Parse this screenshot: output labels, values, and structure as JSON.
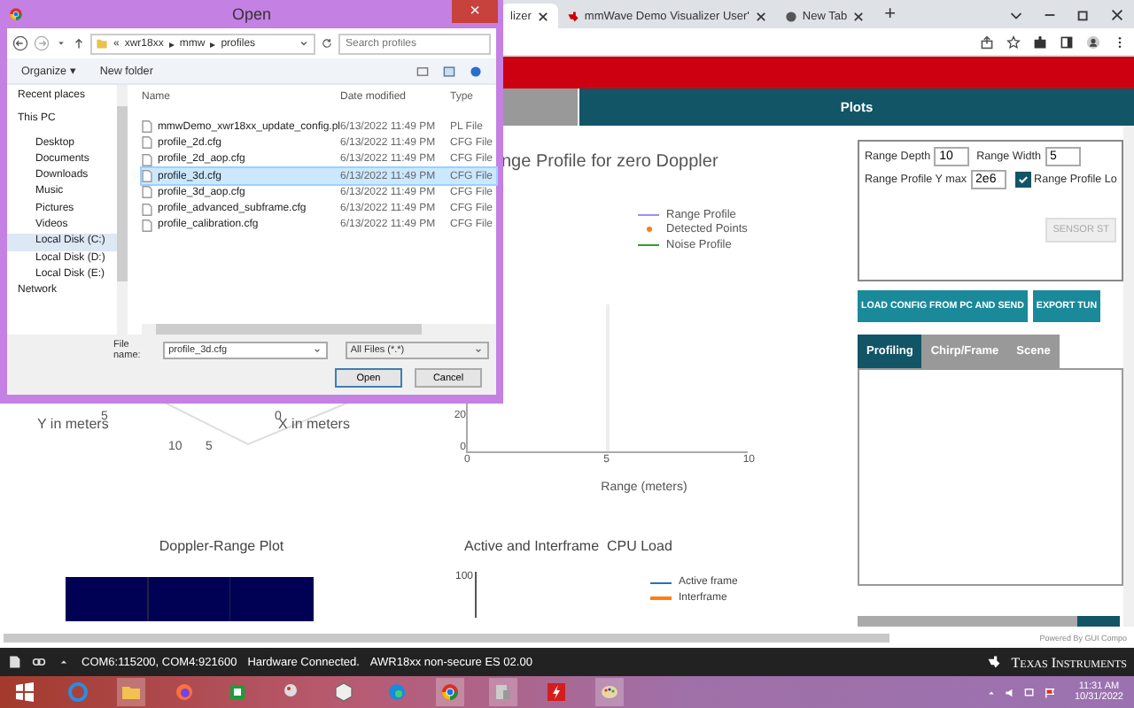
{
  "browser": {
    "tabs": [
      {
        "title": "lizer",
        "selected": true
      },
      {
        "title": "mmWave Demo Visualizer User'",
        "selected": false
      },
      {
        "title": "New Tab",
        "selected": false
      }
    ],
    "new_tab": "+"
  },
  "page_tabs": [
    {
      "selected": false
    },
    {
      "label": "Plots",
      "selected": true
    }
  ],
  "plot_3d": {
    "y_label": "Y in meters",
    "x_label": "X in meters",
    "ticks": [
      "5",
      "0",
      "10",
      "5"
    ]
  },
  "range_profile": {
    "title": "nge Profile for zero Doppler",
    "legend": [
      {
        "label": "Range Profile",
        "kind": "line",
        "color": "#9d8cff"
      },
      {
        "label": "Detected Points",
        "kind": "dot",
        "color": "#ff7f0e"
      },
      {
        "label": "Noise Profile",
        "kind": "line",
        "color": "#2ca02c"
      }
    ],
    "y_ticks": [
      "20",
      "0"
    ],
    "x_ticks": [
      "0",
      "5",
      "10"
    ],
    "xlabel": "Range (meters)"
  },
  "doppler_plot": {
    "title": "Doppler-Range Plot"
  },
  "cpu_load": {
    "title": "Active and Interframe  CPU Load",
    "y_tick": "100",
    "legend": [
      {
        "label": "Active frame",
        "color": "#1f77b4"
      },
      {
        "label": "Interframe",
        "color": "#ff7f0e"
      }
    ]
  },
  "settings": {
    "fields": [
      {
        "label": "Range Depth",
        "value": "10"
      },
      {
        "label": "Range Width",
        "value": "5"
      },
      {
        "label": "Range Profile Y max",
        "value": "2e6"
      }
    ],
    "log_checkbox": {
      "label": "Range Profile Lo",
      "checked": true
    },
    "sensor_button": {
      "label": "SENSOR ST",
      "disabled": true
    }
  },
  "actions": [
    "LOAD CONFIG FROM PC AND SEND",
    "EXPORT TUN"
  ],
  "config_tabs": [
    {
      "label": "Profiling",
      "selected": true
    },
    {
      "label": "Chirp/Frame",
      "selected": false
    },
    {
      "label": "Scene",
      "selected": false
    }
  ],
  "powered_by": "Powered By GUI Compo",
  "status_bar": {
    "ports": "COM6:115200, COM4:921600",
    "connection": "Hardware Connected.",
    "device": "AWR18xx non-secure ES 02.00",
    "brand": "Texas Instruments"
  },
  "taskbar": {
    "time": "11:31 AM",
    "date": "10/31/2022"
  },
  "dialog": {
    "title": "Open",
    "close": "×",
    "path": [
      "«",
      "xwr18xx",
      "▸",
      "mmw",
      "▸",
      "profiles"
    ],
    "search_placeholder": "Search profiles",
    "organize": "Organize ▾",
    "new_folder": "New folder",
    "nav": [
      {
        "label": "Recent places",
        "selected": false
      },
      {
        "label": "This PC",
        "selected": false,
        "children": [
          {
            "label": "Desktop",
            "selected": false
          },
          {
            "label": "Documents",
            "selected": false
          },
          {
            "label": "Downloads",
            "selected": false
          },
          {
            "label": "Music",
            "selected": false
          },
          {
            "label": "Pictures",
            "selected": false
          },
          {
            "label": "Videos",
            "selected": false
          },
          {
            "label": "Local Disk (C:)",
            "selected": true
          },
          {
            "label": "Local Disk (D:)",
            "selected": false
          },
          {
            "label": "Local Disk (E:)",
            "selected": false
          }
        ]
      },
      {
        "label": "Network",
        "selected": false
      }
    ],
    "columns": [
      "Name",
      "Date modified",
      "Type"
    ],
    "files": [
      {
        "name": "mmwDemo_xwr18xx_update_config.pl",
        "date": "6/13/2022 11:49 PM",
        "type": "PL File",
        "selected": false
      },
      {
        "name": "profile_2d.cfg",
        "date": "6/13/2022 11:49 PM",
        "type": "CFG File",
        "selected": false
      },
      {
        "name": "profile_2d_aop.cfg",
        "date": "6/13/2022 11:49 PM",
        "type": "CFG File",
        "selected": false
      },
      {
        "name": "profile_3d.cfg",
        "date": "6/13/2022 11:49 PM",
        "type": "CFG File",
        "selected": true
      },
      {
        "name": "profile_3d_aop.cfg",
        "date": "6/13/2022 11:49 PM",
        "type": "CFG File",
        "selected": false
      },
      {
        "name": "profile_advanced_subframe.cfg",
        "date": "6/13/2022 11:49 PM",
        "type": "CFG File",
        "selected": false
      },
      {
        "name": "profile_calibration.cfg",
        "date": "6/13/2022 11:49 PM",
        "type": "CFG File",
        "selected": false
      }
    ],
    "file_name_label": "File name:",
    "file_name": "profile_3d.cfg",
    "filter": "All Files (*.*)",
    "open": "Open",
    "cancel": "Cancel"
  }
}
